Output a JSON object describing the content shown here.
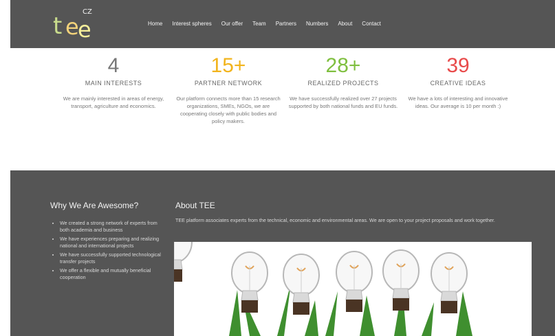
{
  "brand": {
    "logo_t": "t",
    "logo_e1": "e",
    "logo_e2": "e",
    "logo_cz": "CZ",
    "colors": {
      "header_bg": "#555555",
      "section_bg": "#555555",
      "white": "#ffffff"
    }
  },
  "nav": {
    "items": [
      "Home",
      "Interest spheres",
      "Our offer",
      "Team",
      "Partners",
      "Numbers",
      "About",
      "Contact"
    ]
  },
  "stats": [
    {
      "num": "4",
      "label": "MAIN INTERESTS",
      "desc": "We are mainly interested in areas of energy, transport, agriculture and economics.",
      "color": "#777777"
    },
    {
      "num": "15+",
      "label": "PARTNER NETWORK",
      "desc": "Our platform connects more than 15 research organizations, SMEs, NGOs, we are cooperating closely with public bodies and policy makers.",
      "color": "#f2b41c"
    },
    {
      "num": "28+",
      "label": "REALIZED PROJECTS",
      "desc": "We have successfully realized over 27 projects supported by both national funds and EU funds.",
      "color": "#7fbf3f"
    },
    {
      "num": "39",
      "label": "CREATIVE IDEAS",
      "desc": "We have a lots of interesting and innovative ideas. Our average is 10 per month :)",
      "color": "#e84a4a"
    }
  ],
  "why": {
    "title": "Why We Are Awesome?",
    "items": [
      "We created a strong network of experts from both academia and business",
      "We have experiences preparing and realizing national and international projects",
      "We have successfully supported technological transfer projects",
      "We offer a flexible and mutually beneficial cooperation"
    ]
  },
  "about": {
    "title": "About TEE",
    "text": "TEE platform associates experts from the technical, economic and environmental areas. We are open to your project proposals and work together."
  },
  "image": {
    "icon": "light-bulbs-icon"
  }
}
